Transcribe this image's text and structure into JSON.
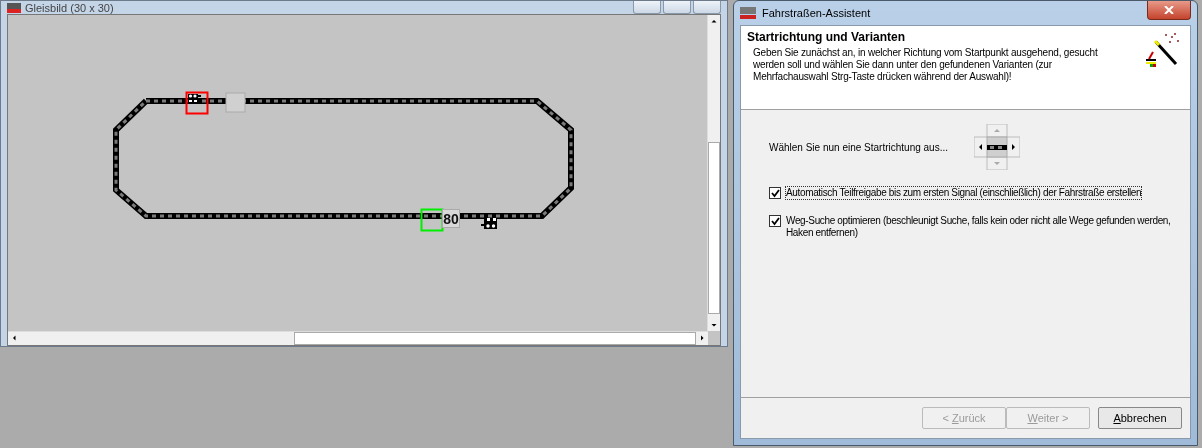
{
  "track_window": {
    "title": "Gleisbild (30 x 30)",
    "speed_label": "80"
  },
  "dialog": {
    "title": "Fahrstraßen-Assistent",
    "heading": "Startrichtung und Varianten",
    "description": "Geben Sie zunächst an, in welcher Richtung vom Startpunkt ausgehend, gesucht werden soll und wählen Sie dann unter den gefundenen Varianten (zur Mehrfachauswahl Strg-Taste drücken während der Auswahl)!",
    "direction_prompt": "Wählen Sie nun eine Startrichtung aus...",
    "options": [
      {
        "label": "Automatisch Teilfreigabe bis zum ersten Signal (einschließlich) der Fahrstraße erstellen",
        "checked": true,
        "focused": true
      },
      {
        "label": "Weg-Suche optimieren (beschleunigt Suche, falls kein oder nicht alle Wege gefunden werden, Haken entfernen)",
        "checked": true,
        "focused": false
      }
    ],
    "buttons": [
      {
        "before_key": "< ",
        "access_key": "Z",
        "after_key": "urück",
        "disabled": true
      },
      {
        "access_key": "W",
        "after_key": "eiter >",
        "disabled": true
      },
      {
        "access_key": "A",
        "after_key": "bbrechen",
        "disabled": false
      }
    ]
  }
}
